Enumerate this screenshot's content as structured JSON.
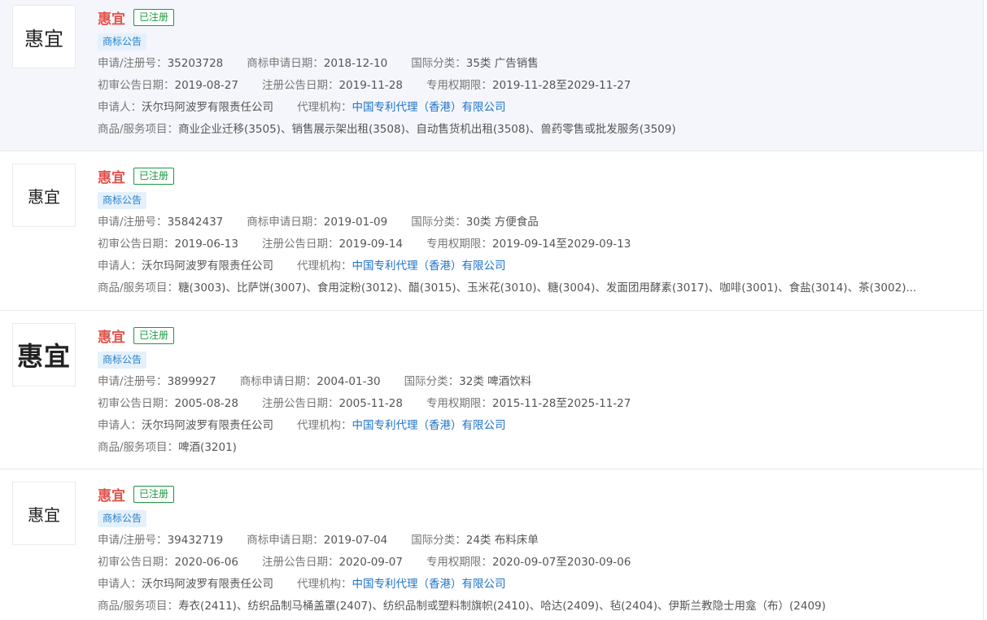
{
  "labels": {
    "reg_no": "申请/注册号：",
    "apply_date": "商标申请日期：",
    "intl_class": "国际分类：",
    "prelim_date": "初审公告日期：",
    "reg_date": "注册公告日期：",
    "term": "专用权期限：",
    "applicant": "申请人：",
    "agent": "代理机构：",
    "goods": "商品/服务项目："
  },
  "colors": {
    "name": "#e5534b",
    "status": "#1a9b41",
    "tag_bg": "#e4f1fc",
    "tag_text": "#2a7fc8",
    "link": "#1f73c7",
    "highlight_bg": "#f4f6fb"
  },
  "items": [
    {
      "logo_text": "惠宜",
      "name": "惠宜",
      "status": "已注册",
      "tag": "商标公告",
      "reg_no": "35203728",
      "apply_date": "2018-12-10",
      "intl_class": "35类 广告销售",
      "prelim_date": "2019-08-27",
      "reg_date": "2019-11-28",
      "term": "2019-11-28至2029-11-27",
      "applicant": "沃尔玛阿波罗有限责任公司",
      "agent": "中国专利代理（香港）有限公司",
      "goods": "商业企业迁移(3505)、销售展示架出租(3508)、自动售货机出租(3508)、兽药零售或批发服务(3509)"
    },
    {
      "logo_text": "惠宜",
      "name": "惠宜",
      "status": "已注册",
      "tag": "商标公告",
      "reg_no": "35842437",
      "apply_date": "2019-01-09",
      "intl_class": "30类 方便食品",
      "prelim_date": "2019-06-13",
      "reg_date": "2019-09-14",
      "term": "2019-09-14至2029-09-13",
      "applicant": "沃尔玛阿波罗有限责任公司",
      "agent": "中国专利代理（香港）有限公司",
      "goods": "糖(3003)、比萨饼(3007)、食用淀粉(3012)、醋(3015)、玉米花(3010)、糖(3004)、发面团用酵素(3017)、咖啡(3001)、食盐(3014)、茶(3002)..."
    },
    {
      "logo_text": "惠宜",
      "name": "惠宜",
      "status": "已注册",
      "tag": "商标公告",
      "reg_no": "3899927",
      "apply_date": "2004-01-30",
      "intl_class": "32类 啤酒饮料",
      "prelim_date": "2005-08-28",
      "reg_date": "2005-11-28",
      "term": "2015-11-28至2025-11-27",
      "applicant": "沃尔玛阿波罗有限责任公司",
      "agent": "中国专利代理（香港）有限公司",
      "goods": "啤酒(3201)"
    },
    {
      "logo_text": "惠宜",
      "name": "惠宜",
      "status": "已注册",
      "tag": "商标公告",
      "reg_no": "39432719",
      "apply_date": "2019-07-04",
      "intl_class": "24类 布料床单",
      "prelim_date": "2020-06-06",
      "reg_date": "2020-09-07",
      "term": "2020-09-07至2030-09-06",
      "applicant": "沃尔玛阿波罗有限责任公司",
      "agent": "中国专利代理（香港）有限公司",
      "goods": "寿衣(2411)、纺织品制马桶盖罩(2407)、纺织品制或塑料制旗帜(2410)、哈达(2409)、毡(2404)、伊斯兰教隐士用龛（布）(2409)"
    }
  ]
}
